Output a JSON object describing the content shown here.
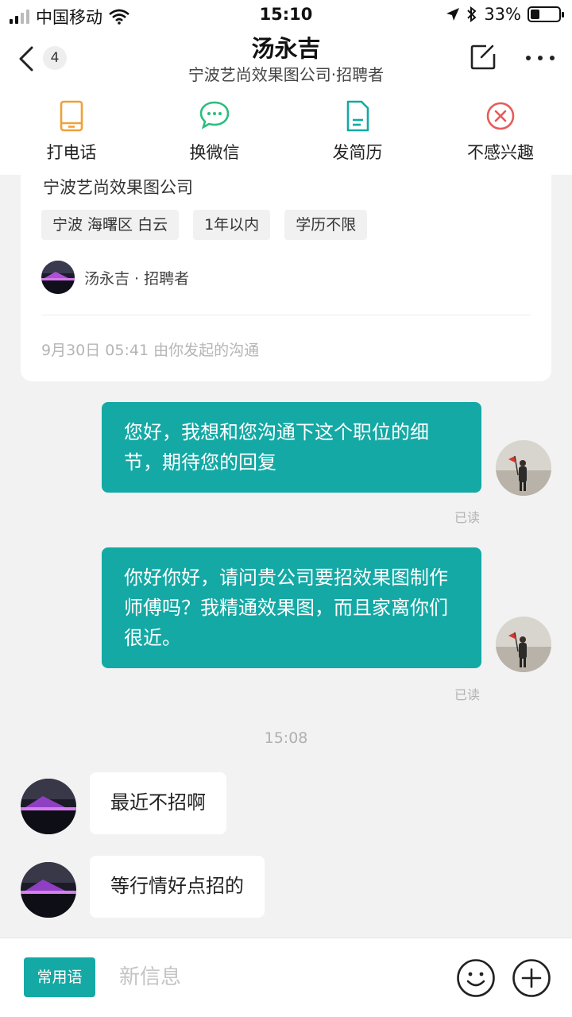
{
  "status_bar": {
    "carrier": "中国移动",
    "time": "15:10",
    "battery_percent": "33%"
  },
  "nav": {
    "unread_count": "4",
    "title": "汤永吉",
    "subtitle": "宁波艺尚效果图公司·招聘者"
  },
  "actions": [
    {
      "label": "打电话",
      "icon": "phone-icon",
      "color": "#f0a135"
    },
    {
      "label": "换微信",
      "icon": "wechat-icon",
      "color": "#2bbd7e"
    },
    {
      "label": "发简历",
      "icon": "resume-icon",
      "color": "#14a9a5"
    },
    {
      "label": "不感兴趣",
      "icon": "not-interested-icon",
      "color": "#e95a5a"
    }
  ],
  "job_card": {
    "company": "宁波艺尚效果图公司",
    "tags": [
      "宁波 海曙区 白云",
      "1年以内",
      "学历不限"
    ],
    "recruiter": "汤永吉 · 招聘者",
    "chat_started": "9月30日 05:41 由你发起的沟通"
  },
  "messages": [
    {
      "from": "me",
      "text": "您好，我想和您沟通下这个职位的细节，期待您的回复",
      "status": "已读"
    },
    {
      "from": "me",
      "text": "你好你好，请问贵公司要招效果图制作师傅吗？我精通效果图，而且家离你们很近。",
      "status": "已读"
    },
    {
      "from": "recruiter",
      "text": "最近不招啊"
    },
    {
      "from": "recruiter",
      "text": "等行情好点招的"
    }
  ],
  "time_separator": "15:08",
  "input_bar": {
    "phrases_label": "常用语",
    "placeholder": "新信息"
  },
  "colors": {
    "accent": "#14a9a5",
    "background": "#f2f2f2"
  }
}
